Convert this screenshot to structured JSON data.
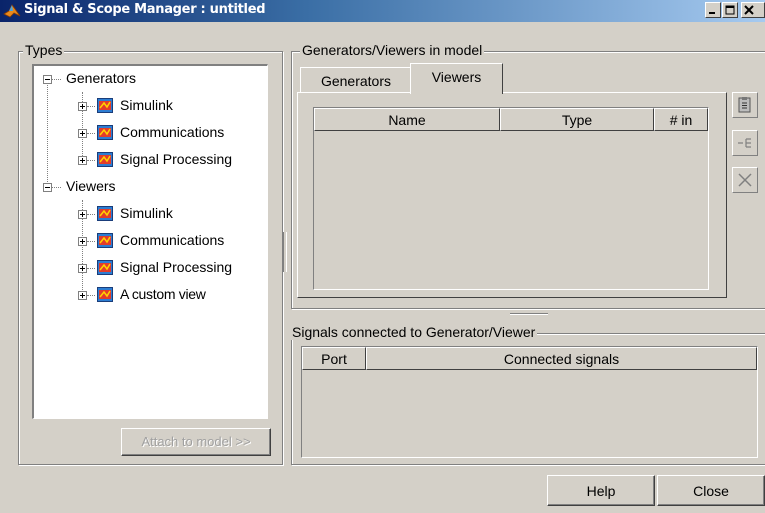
{
  "window": {
    "title": "Signal & Scope Manager : untitled",
    "title_color": "#ffffff",
    "titlebar_color": "#0a246a",
    "controls": [
      "minimize-icon",
      "maximize-icon",
      "close-icon"
    ]
  },
  "types": {
    "group_label": "Types",
    "tree": [
      {
        "label": "Generators",
        "expanded": true,
        "children": [
          {
            "label": "Simulink"
          },
          {
            "label": "Communications"
          },
          {
            "label": "Signal Processing"
          }
        ]
      },
      {
        "label": "Viewers",
        "expanded": true,
        "children": [
          {
            "label": "Simulink"
          },
          {
            "label": "Communications"
          },
          {
            "label": "Signal Processing"
          },
          {
            "label": "A custom view"
          }
        ]
      }
    ],
    "attach_button": "Attach to model >>"
  },
  "model": {
    "group_label": "Generators/Viewers in model",
    "tabs": [
      {
        "label": "Generators",
        "active": false
      },
      {
        "label": "Viewers",
        "active": true
      }
    ],
    "columns": [
      "Name",
      "Type",
      "# in"
    ],
    "side_buttons": [
      "paste-icon",
      "connect-icon",
      "delete-icon"
    ]
  },
  "signals": {
    "group_label": "Signals connected to Generator/Viewer",
    "columns": [
      "Port",
      "Connected signals"
    ]
  },
  "footer": {
    "help": "Help",
    "close": "Close"
  }
}
